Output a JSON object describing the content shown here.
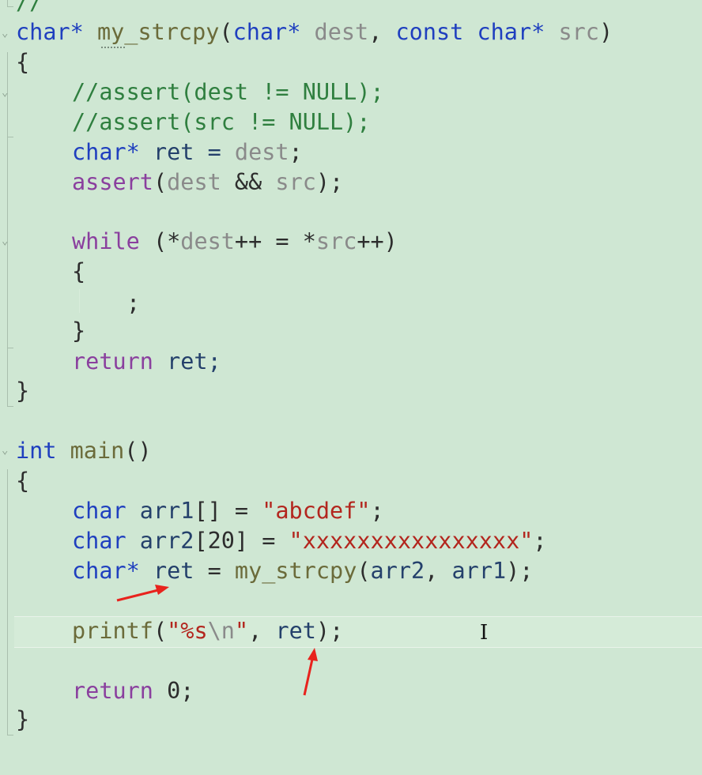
{
  "editor": {
    "lines": {
      "l0": {
        "text": "//"
      },
      "l1": {
        "t_type": "char*",
        "t_name": "my_strcpy",
        "t_open": "(",
        "t_kw1": "char*",
        "t_p1": "dest",
        "t_sep": ", ",
        "t_kw2": "const",
        "t_kw3": "char*",
        "t_p2": "src",
        "t_close": ")"
      },
      "l2": {
        "text": "{"
      },
      "l3": {
        "text": "//assert(dest != NULL);"
      },
      "l4": {
        "text": "//assert(src != NULL);"
      },
      "l5": {
        "t_kw": "char*",
        "t_rest": " ret = ",
        "t_p": "dest",
        "t_end": ";"
      },
      "l6": {
        "t_fn": "assert",
        "t_open": "(",
        "t_p1": "dest",
        "t_op": " && ",
        "t_p2": "src",
        "t_end": ");"
      },
      "l8": {
        "t_kw": "while",
        "t_a": " (*",
        "t_p1": "dest",
        "t_b": "++ = *",
        "t_p2": "src",
        "t_c": "++)"
      },
      "l9": {
        "text": "{"
      },
      "l10": {
        "text": ";"
      },
      "l11": {
        "text": "}"
      },
      "l12": {
        "t_kw": "return",
        "t_rest": " ret;"
      },
      "l13": {
        "text": "}"
      },
      "l15": {
        "t_kw": "int",
        "t_fn": " main",
        "t_rest": "()"
      },
      "l16": {
        "text": "{"
      },
      "l17": {
        "t_kw": "char",
        "t_var": " arr1",
        "t_mid": "[] = ",
        "t_str": "\"abcdef\"",
        "t_end": ";"
      },
      "l18": {
        "t_kw": "char",
        "t_var": " arr2",
        "t_mid": "[20] = ",
        "t_str": "\"xxxxxxxxxxxxxxxx\"",
        "t_end": ";"
      },
      "l19": {
        "t_kw": "char*",
        "t_var": " ret",
        "t_mid": " = ",
        "t_fn": "my_strcpy",
        "t_open": "(",
        "t_a1": "arr2",
        "t_sep": ", ",
        "t_a2": "arr1",
        "t_end": ");"
      },
      "l21": {
        "t_fn": "printf",
        "t_open": "(",
        "t_str1": "\"%s",
        "t_esc": "\\n",
        "t_str2": "\"",
        "t_sep": ", ",
        "t_var": "ret",
        "t_end": ");"
      },
      "l23": {
        "t_kw": "return",
        "t_num": " 0",
        "t_end": ";"
      },
      "l24": {
        "text": "}"
      }
    }
  },
  "colors": {
    "background": "#cfe7d3",
    "keyword": "#1f3fbf",
    "control": "#8a3f9e",
    "string": "#b3261e",
    "arrow": "#e8231d"
  },
  "icons": [
    "fold-chevron-icon",
    "text-cursor-icon",
    "red-arrow-annotation"
  ]
}
